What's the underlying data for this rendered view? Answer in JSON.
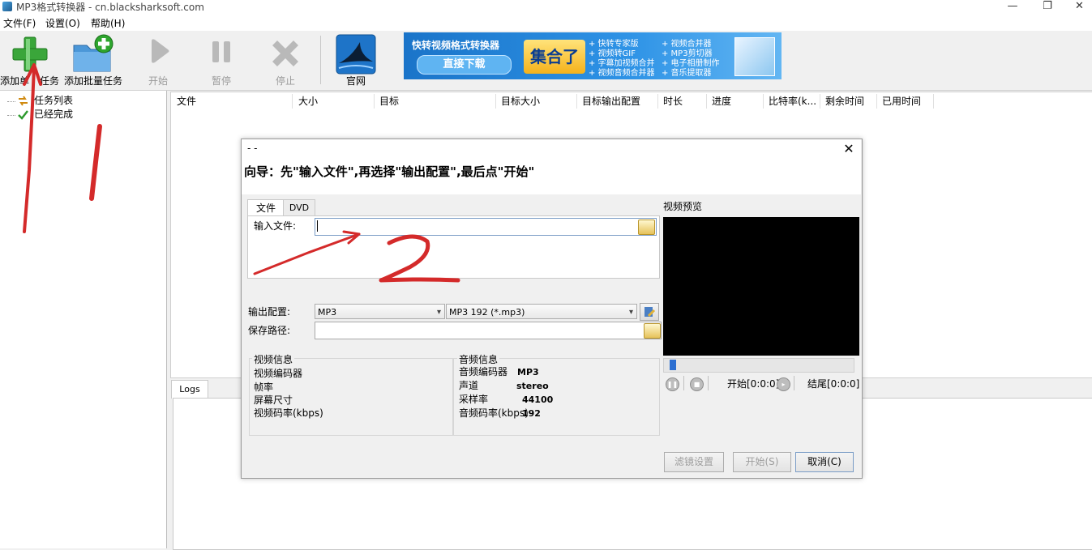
{
  "window": {
    "title": "MP3格式转换器 - cn.blacksharksoft.com",
    "controls": {
      "minimize": "—",
      "maximize": "❐",
      "close": "✕"
    }
  },
  "menu": [
    {
      "label": "文件(F)"
    },
    {
      "label": "设置(O)"
    },
    {
      "label": "帮助(H)"
    }
  ],
  "toolbar": {
    "add_single": "添加单",
    "add_single_tail": "任务",
    "add_batch": "添加批量任务",
    "start": "开始",
    "pause": "暂停",
    "stop": "停止",
    "website": "官网"
  },
  "banner": {
    "title": "快转视频格式转换器",
    "download": "直接下载",
    "center": "集合了",
    "features_col1": [
      "+ 快转专家版",
      "+ 视频转GIF",
      "+ 字幕加视频合并",
      "+ 视频音频合并器"
    ],
    "features_col2": [
      "+ 视频合并器",
      "+ MP3剪切器",
      "+ 电子相册制作",
      "+ 音乐提取器"
    ]
  },
  "tree": [
    {
      "label": "任务列表"
    },
    {
      "label": "已经完成"
    }
  ],
  "columns": [
    "文件",
    "大小",
    "目标",
    "目标大小",
    "目标输出配置",
    "时长",
    "进度",
    "比特率(k...",
    "剩余时间",
    "已用时间"
  ],
  "logs": {
    "tab": "Logs"
  },
  "dialog": {
    "title": "- -",
    "close": "✕",
    "guide": "向导：先\"输入文件\",再选择\"输出配置\",最后点\"开始\"",
    "tabs": [
      {
        "label": "文件"
      },
      {
        "label": "DVD"
      }
    ],
    "input_file_label": "输入文件:",
    "input_file_value": "",
    "output_config_label": "输出配置:",
    "format": "MP3",
    "preset": "MP3 192 (*.mp3)",
    "save_path_label": "保存路径:",
    "save_path_value": "",
    "video_info": {
      "title": "视频信息",
      "rows": [
        "视频编码器",
        "帧率",
        "屏幕尺寸",
        "视频码率(kbps)"
      ]
    },
    "audio_info": {
      "title": "音频信息",
      "rows": [
        {
          "label": "音频编码器",
          "value": "MP3"
        },
        {
          "label": "声道",
          "value": "stereo"
        },
        {
          "label": "采样率",
          "value": "44100"
        },
        {
          "label": "音频码率(kbps)",
          "value": "192"
        }
      ]
    },
    "preview": {
      "title": "视频预览",
      "start": "开始[0:0:0]",
      "end": "结尾[0:0:0]"
    },
    "buttons": {
      "filter": "滤镜设置",
      "start": "开始(S)",
      "cancel": "取消(C)"
    }
  },
  "annotations": {
    "first": "1",
    "second": "2",
    "color": "#d42a2a"
  }
}
